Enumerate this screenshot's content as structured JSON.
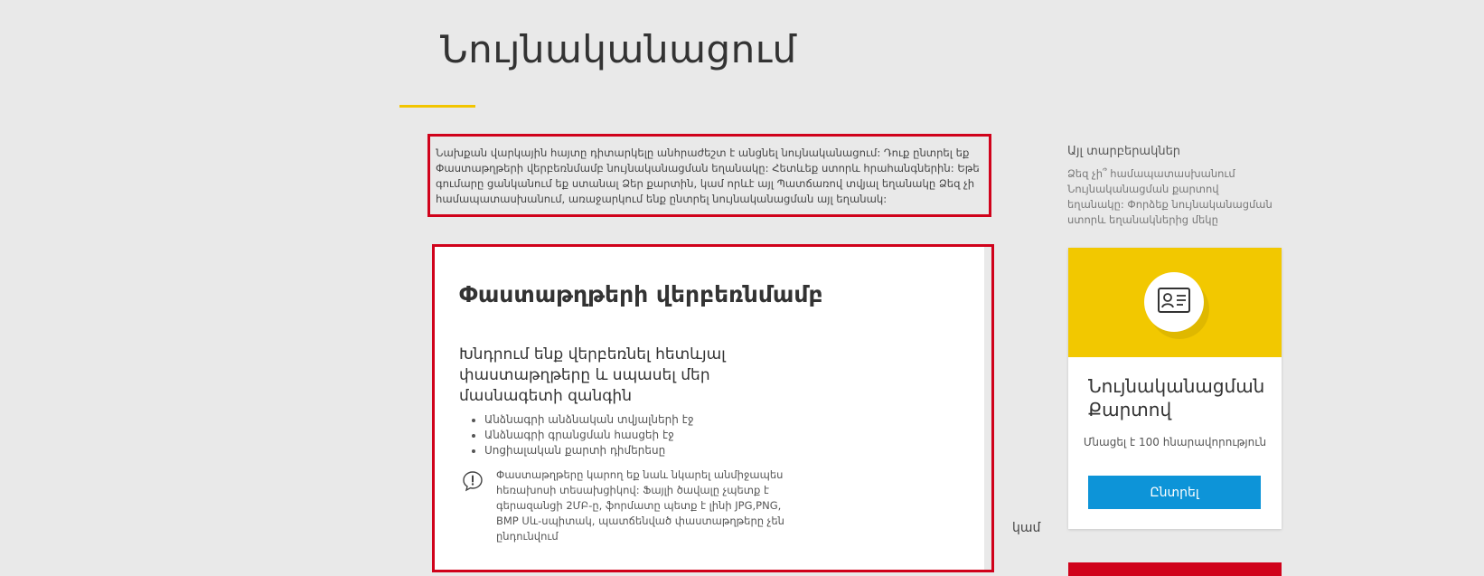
{
  "page": {
    "title": "Նույնականացում"
  },
  "intro": {
    "text": "Նախքան վարկային հայտը դիտարկելը անհրաժեշտ է անցնել նույնականացում: Դուք ընտրել եք Փաստաթղթերի վերբեռնմամբ նույնականացման եղանակը: Հետևեք ստորև հրահանգներին: Եթե գումարը ցանկանում եք ստանալ Ձեր քարտին, կամ որևէ այլ Պատճառով տվյալ եղանակը Ձեզ չի համապատասխանում, առաջարկում ենք ընտրել նույնականացման այլ եղանակ:"
  },
  "doc_card": {
    "title": "Փաստաթղթերի վերբեռնմամբ",
    "lead": "Խնդրում ենք վերբեռնել հետևյալ փաստաթղթերը և սպասել մեր մասնագետի զանգին",
    "items": [
      "Անձնագրի անձնական տվյալների էջ",
      "Անձնագրի գրանցման հասցեի էջ",
      "Սոցիալական քարտի դիմերեսը"
    ],
    "notice": "Փաստաթղթերը կարող եք նաև նկարել անմիջապես հեռախոսի տեսախցիկով: Ֆայլի ծավալը չպետք է գերազանցի 2ՄԲ-ը, ֆորմատը պետք է լինի JPG,PNG, BMP Սև-սպիտակ, պատճենված փաստաթղթերը չեն ընդունվում",
    "notice_icon": "exclamation-bubble-icon"
  },
  "or_text": "կամ",
  "sidebar": {
    "title": "Այլ տարբերակներ",
    "description": "Ձեզ չի՞ համապատասխանում Նույնականացման քարտով եղանակը: Փորձեք նույնականացման ստորև եղանակներից մեկը",
    "id_card": {
      "icon": "id-card-icon",
      "title": "Նույնականացման Քարտով",
      "balance": "Մնացել է 100 հնարավորություն",
      "button": "Ընտրել",
      "accent_color": "#f2c800",
      "button_color": "#0d94d8"
    }
  },
  "colors": {
    "highlight": "#d0021b",
    "underline": "#f2c500",
    "background": "#e9e9e9"
  }
}
